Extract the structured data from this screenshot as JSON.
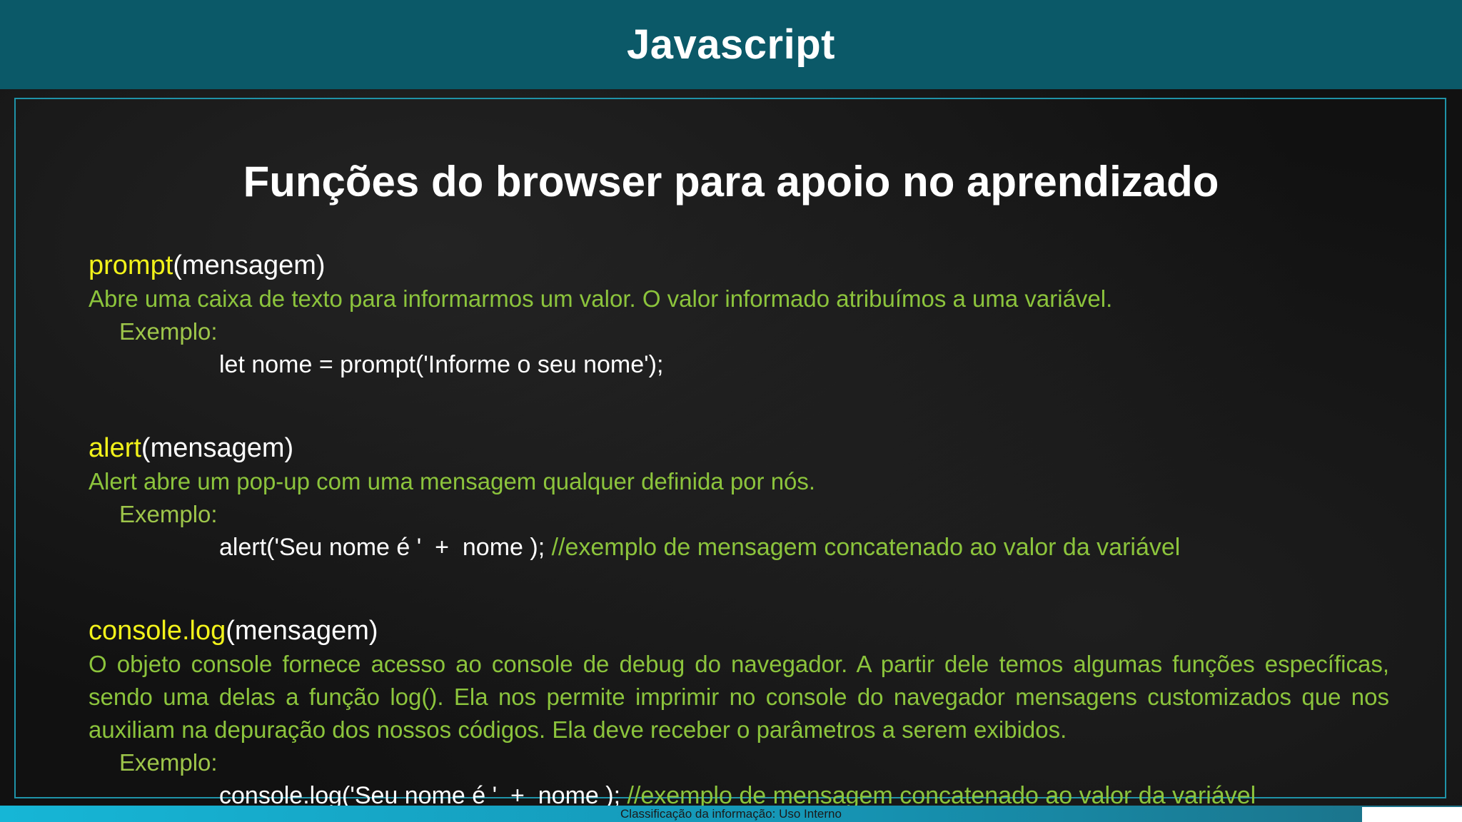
{
  "header": {
    "title": "Javascript"
  },
  "slide": {
    "title": "Funções do browser para apoio no aprendizado"
  },
  "functions": [
    {
      "name": "prompt",
      "params": "(mensagem)",
      "description": "Abre uma caixa de texto para informarmos um valor. O valor informado atribuímos a uma variável.",
      "example_label": "Exemplo:",
      "example_code": "let nome = prompt('Informe o seu nome');",
      "example_comment": ""
    },
    {
      "name": "alert",
      "params": "(mensagem)",
      "description": "Alert abre um pop-up com uma mensagem qualquer definida por nós.",
      "example_label": "Exemplo:",
      "example_code": "alert('Seu nome é '  +  nome ); ",
      "example_comment": "//exemplo de mensagem concatenado ao valor da variável"
    },
    {
      "name": "console.log",
      "params": "(mensagem)",
      "description": "O objeto console fornece acesso ao console de debug do navegador. A partir dele temos algumas funções específicas, sendo uma delas a função log(). Ela nos permite imprimir no console do navegador mensagens customizados que nos auxiliam na depuração dos nossos códigos. Ela deve receber o parâmetros a serem exibidos.",
      "example_label": "Exemplo:",
      "example_code": "console.log('Seu nome é '  +  nome ); ",
      "example_comment": "//exemplo de mensagem concatenado ao valor da variável"
    }
  ],
  "footer": {
    "classification": "Classificação da informação: Uso Interno"
  },
  "colors": {
    "header_bg": "#0b5968",
    "frame_border": "#1f93a8",
    "function_name": "#f2f21a",
    "description": "#8cc43c",
    "code": "#ffffff"
  }
}
